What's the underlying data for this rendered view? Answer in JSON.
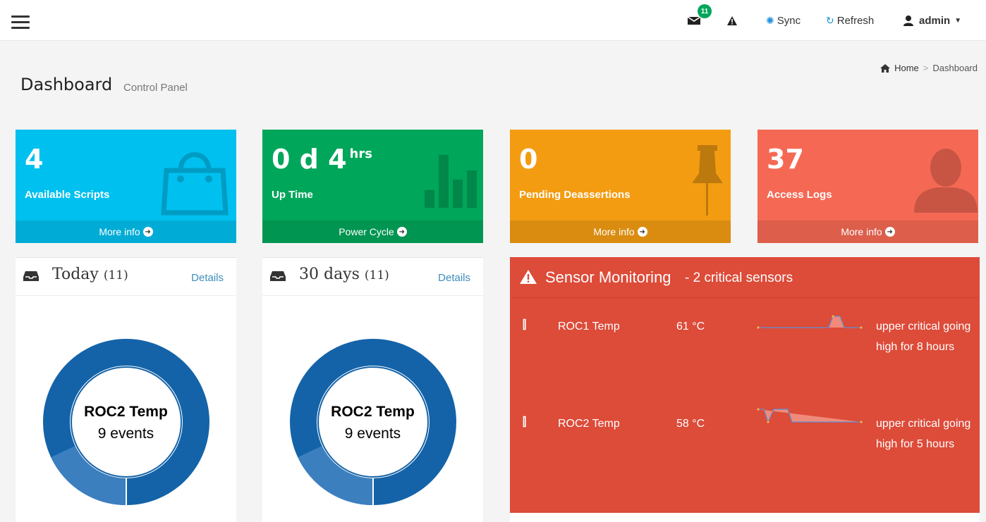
{
  "navbar": {
    "mail_badge": "11",
    "sync_label": "Sync",
    "refresh_label": "Refresh",
    "user_label": "admin"
  },
  "header": {
    "title": "Dashboard",
    "subtitle": "Control Panel",
    "breadcrumb": {
      "home": "Home",
      "current": "Dashboard"
    }
  },
  "boxes": [
    {
      "value": "4",
      "label": "Available Scripts",
      "footer": "More info",
      "color": "#00c0ef",
      "icon": "shopping-bag-icon"
    },
    {
      "value": "0 d 4",
      "sup": "hrs",
      "label": "Up Time",
      "footer": "Power Cycle",
      "color": "#00a65a",
      "icon": "bar-chart-icon"
    },
    {
      "value": "0",
      "label": "Pending Deassertions",
      "footer": "More info",
      "color": "#f39c12",
      "icon": "pushpin-icon"
    },
    {
      "value": "37",
      "label": "Access Logs",
      "footer": "More info",
      "color": "#f56954",
      "icon": "user-icon"
    }
  ],
  "panels": [
    {
      "title": "Today",
      "count": "(11)",
      "link": "Details",
      "donut_title": "ROC2 Temp",
      "donut_sub": "9 events",
      "donut_fraction": 0.82
    },
    {
      "title": "30 days",
      "count": "(11)",
      "link": "Details",
      "donut_title": "ROC2 Temp",
      "donut_sub": "9 events",
      "donut_fraction": 0.82
    }
  ],
  "sensor": {
    "title": "Sensor Monitoring",
    "subtitle": "- 2 critical sensors",
    "color": "#dd4b39",
    "rows": [
      {
        "name": "ROC1 Temp",
        "value": "61 °C",
        "desc": "upper critical going high for 8 hours"
      },
      {
        "name": "ROC2 Temp",
        "value": "58 °C",
        "desc": "upper critical going high for 5 hours"
      }
    ]
  }
}
